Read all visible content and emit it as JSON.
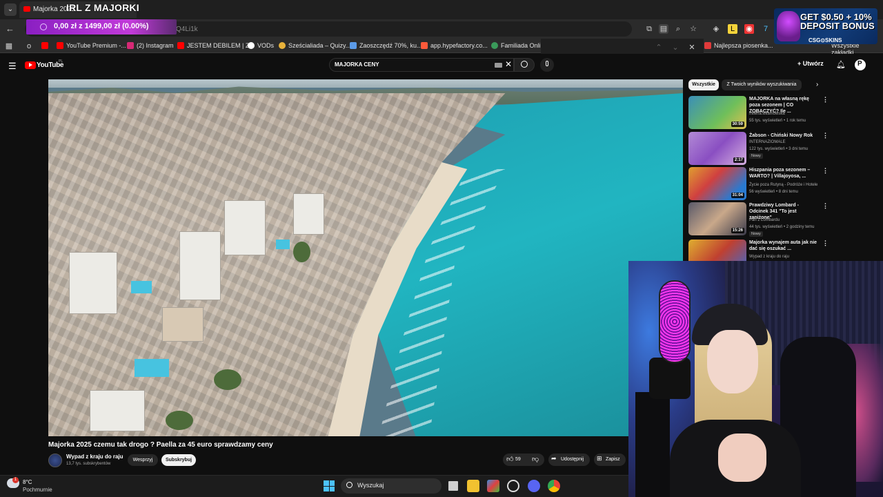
{
  "browser": {
    "tab_title": "Majorka 2025",
    "stream_title": "IRL Z MAJORKI",
    "url_fragment": "Q4Li1k",
    "donation_goal": "0,00 zł z 1499,00 zł (0.00%)",
    "bookmarks": [
      {
        "label": "YouTube Premium -...",
        "icon_color": "#ff0000"
      },
      {
        "label": "(2) Instagram",
        "icon_color": "#d62976"
      },
      {
        "label": "JESTEM DEBILEM | Z...",
        "icon_color": "#ff0000"
      },
      {
        "label": "VODs",
        "icon_color": "#ffffff"
      },
      {
        "label": "Sześcialiada – Quizy...",
        "icon_color": "#e8b23a"
      },
      {
        "label": "Zaoszczędź 70%, ku...",
        "icon_color": "#5b9be8"
      },
      {
        "label": "app.hypefactory.co...",
        "icon_color": "#ff5a3a"
      },
      {
        "label": "Familiada Online",
        "icon_color": "#3a9a5a"
      },
      {
        "label": "Najlepsza piosenka...",
        "icon_color": "#e03a3a"
      },
      {
        "label": "Wszystkie zakładki",
        "icon_color": "#cccccc"
      }
    ]
  },
  "ad": {
    "headline": "GET $0.50 + 10% DEPOSIT BONUS",
    "brand": "CSG⊙SKINS"
  },
  "youtube": {
    "logo_text": "YouTube",
    "region": "PL",
    "search_query": "MAJORKA CENY",
    "create_label": "Utwórz",
    "avatar_letter": "P"
  },
  "video": {
    "title": "Majorka 2025 czemu tak drogo ? Paella za 45 euro sprawdzamy ceny",
    "channel": "Wypad z kraju do raju",
    "subscribers": "13,7 tys. subskrybentów",
    "support_label": "Wesprzyj",
    "subscribe_label": "Subskrybuj",
    "likes": "59",
    "share_label": "Udostępnij",
    "save_label": "Zapisz"
  },
  "sidebar": {
    "chips": [
      "Wszystkie",
      "Z Twoich wyników wyszukiwania"
    ],
    "recommendations": [
      {
        "title": "MAJORKA na własną rękę poza sezonem | CO ZOBACZYĆ? Ile ...",
        "channel": "milena.wilamowska",
        "meta": "55 tys. wyświetleń • 1 rok temu",
        "duration": "30:59",
        "badge": ""
      },
      {
        "title": "Żabson - Chiński Nowy Rok",
        "channel": "INTERNAZIOMALE",
        "meta": "122 tys. wyświetleń • 3 dni temu",
        "duration": "2:17",
        "badge": "Nowy"
      },
      {
        "title": "Hiszpania poza sezonem – WARTO? | Villajoyosa, ...",
        "channel": "Życie poza Rutyną - Podróże i Hotele",
        "meta": "56 wyświetleń • 8 dni temu",
        "duration": "31:04",
        "badge": ""
      },
      {
        "title": "Prawdziwy Lombard - Odcinek 341 \"To jest zaniżone\"",
        "channel": "Pan z Lombardu",
        "meta": "44 tys. wyświetleń • 2 godziny temu",
        "duration": "15:26",
        "badge": "Nowy"
      },
      {
        "title": "Majorka wynajem auta jak nie dać się oszukać ...",
        "channel": "Wypad z kraju do raju",
        "meta": "",
        "duration": "",
        "badge": ""
      }
    ]
  },
  "taskbar": {
    "temperature": "8°C",
    "weather": "Pochmurnie",
    "weather_badge": "1",
    "search_label": "Wyszukaj"
  }
}
